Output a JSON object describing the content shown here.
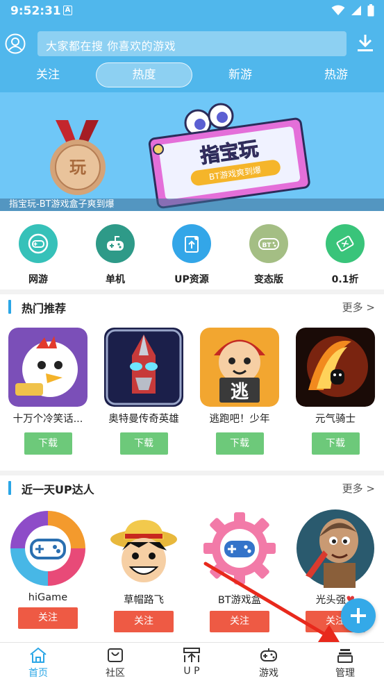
{
  "status_bar": {
    "time": "9:52:31",
    "notification_letter": "A"
  },
  "header": {
    "search": {
      "placeholder": "大家都在搜  你喜欢的游戏"
    },
    "tabs": [
      {
        "label": "关注"
      },
      {
        "label": "热度",
        "active": true
      },
      {
        "label": "新游"
      },
      {
        "label": "热游"
      }
    ]
  },
  "banner": {
    "caption": "指宝玩-BT游戏盒子爽到爆",
    "logo_text": "指宝玩",
    "logo_subtext": "BT游戏爽到爆",
    "medal_text": "玩"
  },
  "categories": [
    {
      "label": "网游",
      "color": "#36c1b9",
      "icon": "gamepad-icon"
    },
    {
      "label": "单机",
      "color": "#2e9a88",
      "icon": "joystick-icon"
    },
    {
      "label": "UP资源",
      "color": "#33a6e8",
      "icon": "upload-share-icon"
    },
    {
      "label": "变态版",
      "color": "#a4be84",
      "icon": "bt-gamepad-icon"
    },
    {
      "label": "0.1折",
      "color": "#39c47a",
      "icon": "discount-ticket-icon"
    }
  ],
  "hot_section": {
    "title": "热门推荐",
    "more": "更多 >",
    "games": [
      {
        "name": "十万个冷笑话...",
        "button": "下载"
      },
      {
        "name": "奥特曼传奇英雄",
        "button": "下载"
      },
      {
        "name": "逃跑吧！少年",
        "button": "下载",
        "icon_text": "逃"
      },
      {
        "name": "元气骑士",
        "button": "下载"
      }
    ]
  },
  "up_section": {
    "title": "近一天UP达人",
    "more": "更多 >",
    "users": [
      {
        "name": "hiGame",
        "button": "关注"
      },
      {
        "name": "草帽路飞",
        "button": "关注"
      },
      {
        "name": "BT游戏盒",
        "button": "关注"
      },
      {
        "name": "光头强",
        "button": "关注"
      }
    ]
  },
  "bottom_nav": [
    {
      "label": "首页",
      "icon": "home-icon",
      "active": true
    },
    {
      "label": "社区",
      "icon": "community-icon"
    },
    {
      "label": "U P",
      "icon": "up-icon"
    },
    {
      "label": "游戏",
      "icon": "gamepad-icon"
    },
    {
      "label": "管理",
      "icon": "manage-icon"
    }
  ],
  "colors": {
    "header_blue": "#50b7ec",
    "accent_blue": "#2aa6e6",
    "download_green": "#6dc97a",
    "follow_red": "#ee5a44"
  }
}
